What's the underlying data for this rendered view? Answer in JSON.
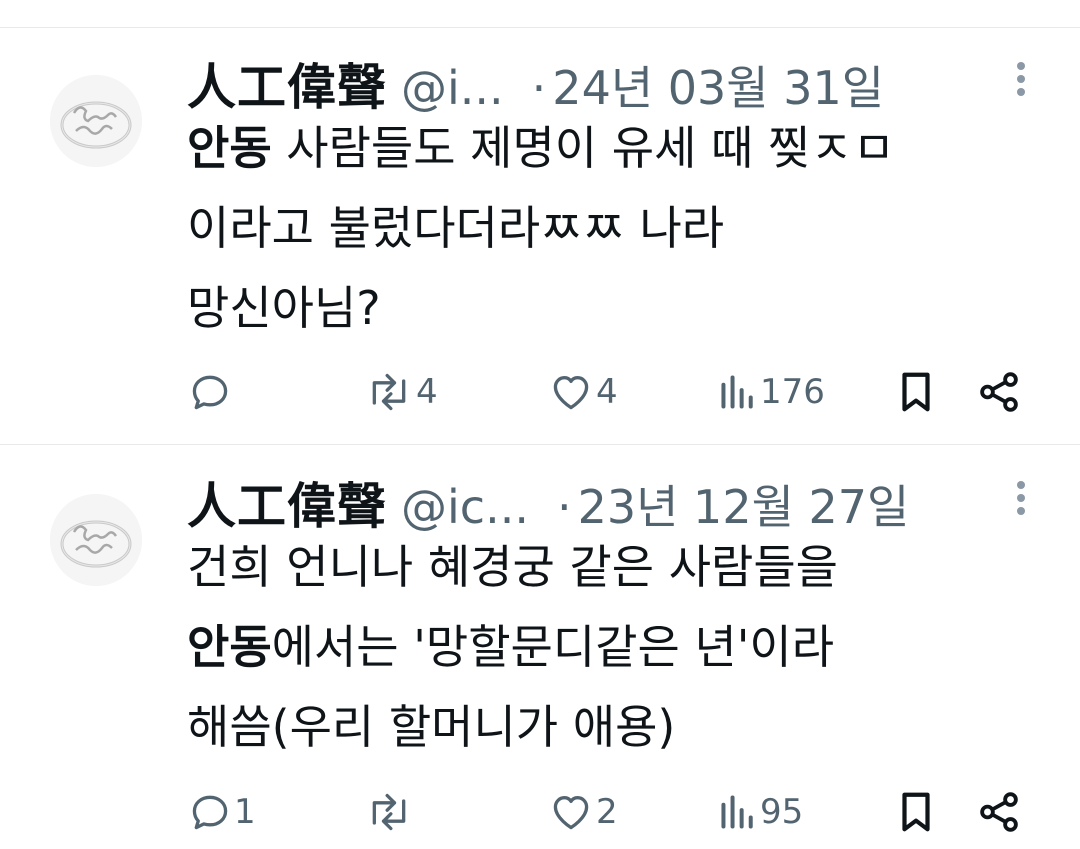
{
  "tweets": [
    {
      "display_name": "人工偉聲",
      "handle": "@i...",
      "separator": "·",
      "date": "24년 03월 31일",
      "lines": [
        {
          "bold": "안동",
          "rest": " 사람들도 제명이 유세 때 찢ㅈㅁ"
        },
        {
          "bold": "",
          "rest": "이라고  불렀다더라ㅉㅉ 나라"
        },
        {
          "bold": "",
          "rest": "망신아님?"
        }
      ],
      "stats": {
        "replies": "",
        "reposts": "4",
        "likes": "4",
        "views": "176"
      }
    },
    {
      "display_name": "人工偉聲",
      "handle": "@ic...",
      "separator": "·",
      "date": "23년 12월 27일",
      "lines": [
        {
          "bold": "",
          "rest": "건희 언니나 혜경궁 같은 사람들을"
        },
        {
          "bold": "안동",
          "rest": "에서는 '망할문디같은 년'이라"
        },
        {
          "bold": "",
          "rest": "해씀(우리 할머니가 애용)"
        }
      ],
      "stats": {
        "replies": "1",
        "reposts": "",
        "likes": "2",
        "views": "95"
      }
    }
  ],
  "icons": {
    "reply": "reply-icon",
    "repost": "repost-icon",
    "like": "heart-icon",
    "views": "views-icon",
    "bookmark": "bookmark-icon",
    "share": "share-icon",
    "more": "more-icon"
  },
  "colors": {
    "text": "#0f1419",
    "secondary": "#536471",
    "divider": "#e7e9ea"
  }
}
